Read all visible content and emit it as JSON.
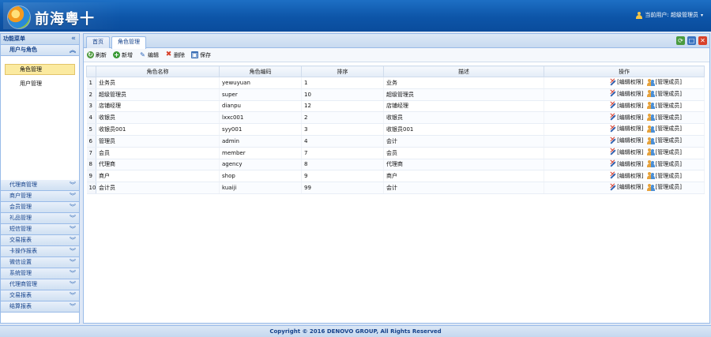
{
  "app": {
    "logo_text": "前海粤十"
  },
  "header": {
    "user_label": "当前用户: 超级管理员"
  },
  "sidebar": {
    "title": "功能菜单",
    "collapse_icon": "«",
    "open_group": {
      "label": "用户与角色",
      "items": [
        {
          "label": "角色管理",
          "active": true
        },
        {
          "label": "用户管理",
          "active": false
        }
      ]
    },
    "groups": [
      {
        "label": "代理商管理"
      },
      {
        "label": "商户管理"
      },
      {
        "label": "会员管理"
      },
      {
        "label": "礼品管理"
      },
      {
        "label": "短信管理"
      },
      {
        "label": "交易报表"
      },
      {
        "label": "卡操作报表"
      },
      {
        "label": "微信设置"
      },
      {
        "label": "系统管理"
      },
      {
        "label": "代理商管理"
      },
      {
        "label": "交易报表"
      },
      {
        "label": "结算报表"
      }
    ]
  },
  "tabs": [
    {
      "label": "首页"
    },
    {
      "label": "角色管理"
    }
  ],
  "toolbar": {
    "refresh": "刷新",
    "add": "新增",
    "edit": "编辑",
    "delete": "删除",
    "save": "保存"
  },
  "table": {
    "columns": [
      "角色名称",
      "角色编码",
      "排序",
      "描述",
      "操作"
    ],
    "action_edit": "[编辑权限]",
    "action_members": "[管理成员]",
    "rows": [
      {
        "n": "1",
        "name": "业务员",
        "code": "yewuyuan",
        "sort": "1",
        "desc": "业务"
      },
      {
        "n": "2",
        "name": "超级管理员",
        "code": "super",
        "sort": "10",
        "desc": "超级管理员"
      },
      {
        "n": "3",
        "name": "店铺经理",
        "code": "dianpu",
        "sort": "12",
        "desc": "店铺经理"
      },
      {
        "n": "4",
        "name": "收银员",
        "code": "lxxc001",
        "sort": "2",
        "desc": "收银员"
      },
      {
        "n": "5",
        "name": "收银员001",
        "code": "syy001",
        "sort": "3",
        "desc": "收银员001"
      },
      {
        "n": "6",
        "name": "管理员",
        "code": "admin",
        "sort": "4",
        "desc": "会计"
      },
      {
        "n": "7",
        "name": "会员",
        "code": "member",
        "sort": "7",
        "desc": "会员"
      },
      {
        "n": "8",
        "name": "代理商",
        "code": "agency",
        "sort": "8",
        "desc": "代理商"
      },
      {
        "n": "9",
        "name": "商户",
        "code": "shop",
        "sort": "9",
        "desc": "商户"
      },
      {
        "n": "10",
        "name": "会计员",
        "code": "kuaiji",
        "sort": "99",
        "desc": "会计"
      }
    ]
  },
  "footer": {
    "text": "Copyright © 2016 DENOVO GROUP, All Rights Reserved"
  }
}
